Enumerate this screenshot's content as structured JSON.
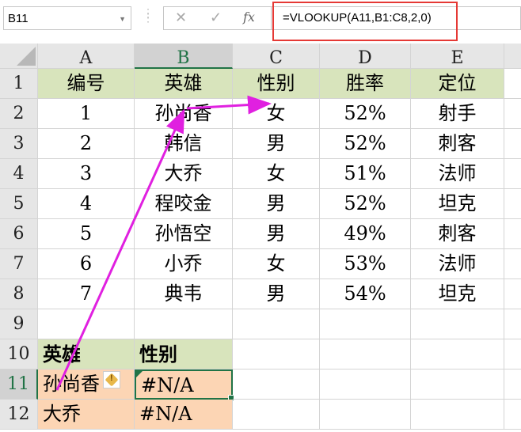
{
  "formula_bar": {
    "name_box": "B11",
    "cancel": "✕",
    "enter": "✓",
    "fx": "fx",
    "formula": "=VLOOKUP(A11,B1:C8,2,0)"
  },
  "columns": [
    "A",
    "B",
    "C",
    "D",
    "E"
  ],
  "rows": [
    "1",
    "2",
    "3",
    "4",
    "5",
    "6",
    "7",
    "8",
    "9",
    "10",
    "11",
    "12"
  ],
  "table": {
    "headers": [
      "编号",
      "英雄",
      "性别",
      "胜率",
      "定位"
    ],
    "data": [
      [
        "1",
        "孙尚香",
        "女",
        "52%",
        "射手"
      ],
      [
        "2",
        "韩信",
        "男",
        "52%",
        "刺客"
      ],
      [
        "3",
        "大乔",
        "女",
        "51%",
        "法师"
      ],
      [
        "4",
        "程咬金",
        "男",
        "52%",
        "坦克"
      ],
      [
        "5",
        "孙悟空",
        "男",
        "49%",
        "刺客"
      ],
      [
        "6",
        "小乔",
        "女",
        "53%",
        "法师"
      ],
      [
        "7",
        "典韦",
        "男",
        "54%",
        "坦克"
      ]
    ]
  },
  "lookup": {
    "headers": [
      "英雄",
      "性别"
    ],
    "data": [
      [
        "孙尚香",
        "#N/A"
      ],
      [
        "大乔",
        "#N/A"
      ]
    ]
  },
  "colors": {
    "header_fill": "#d8e4bc",
    "lookup_fill": "#fcd5b4",
    "arrow": "#e020e0",
    "highlight": "#e53935"
  }
}
